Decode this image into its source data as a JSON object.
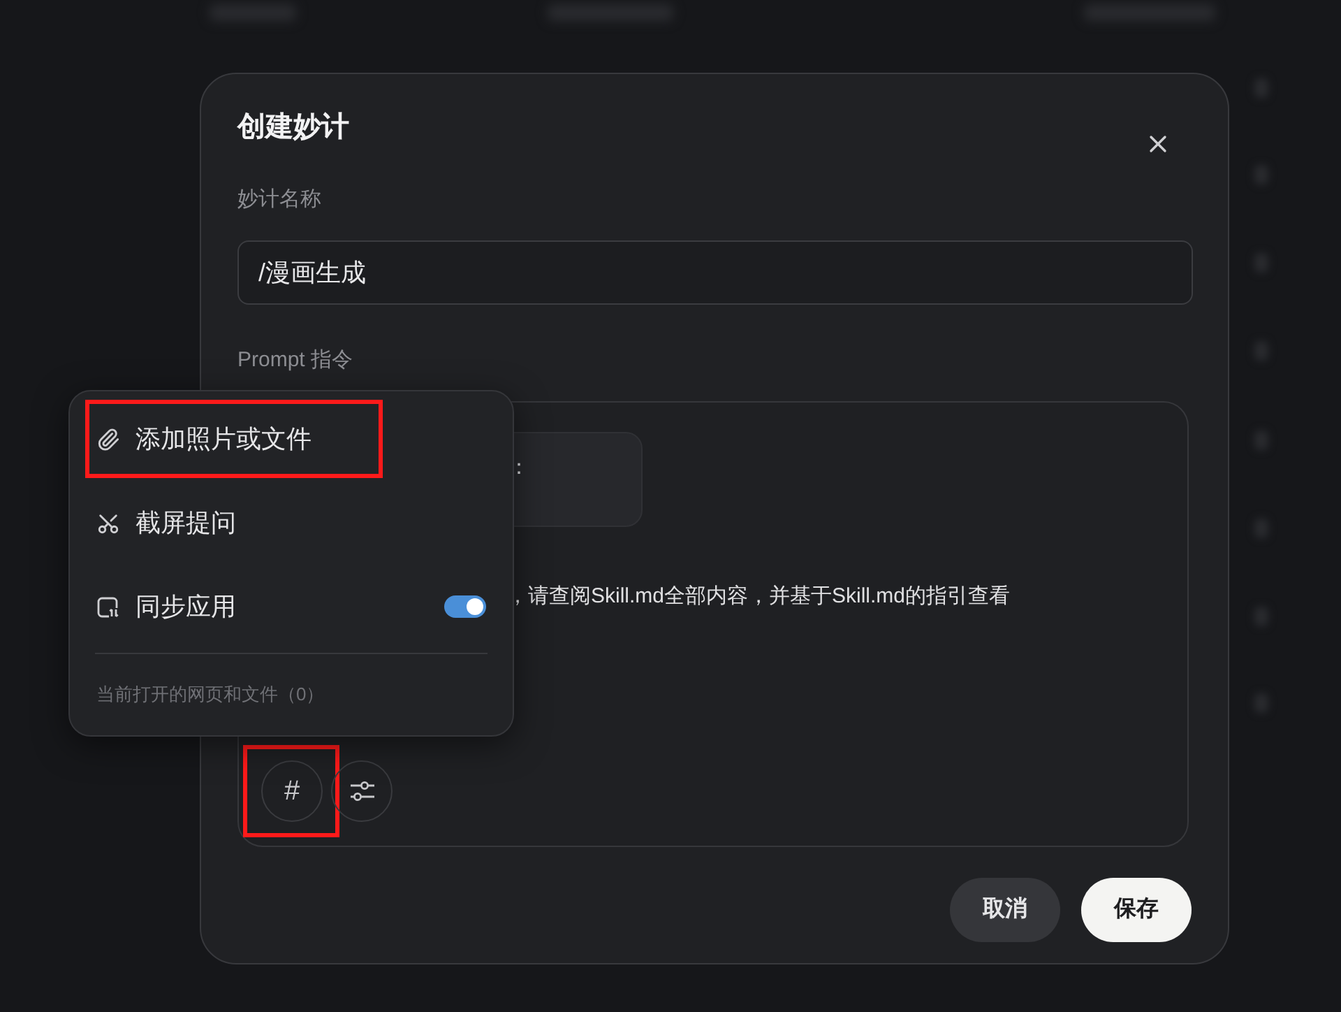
{
  "dialog": {
    "title": "创建妙计",
    "name_label": "妙计名称",
    "name_value": "/漫画生成",
    "prompt_label": "Prompt 指令",
    "prompt": {
      "chip_text": "：",
      "text": "，请查阅Skill.md全部内容，并基于Skill.md的指引查看"
    },
    "tools": [
      {
        "kind": "hash",
        "label": "#",
        "annotated": true
      },
      {
        "kind": "sliders",
        "annotated": false
      }
    ],
    "buttons": [
      {
        "kind": "secondary",
        "label": "取消"
      },
      {
        "kind": "primary",
        "label": "保存"
      }
    ]
  },
  "menu": {
    "items": [
      {
        "kind": "attach",
        "label": "添加照片或文件",
        "annotated": true
      },
      {
        "kind": "screenshot",
        "label": "截屏提问",
        "annotated": false
      },
      {
        "kind": "sync",
        "label": "同步应用",
        "annotated": false,
        "on": true
      }
    ],
    "footer": "当前打开的网页和文件（0）"
  }
}
